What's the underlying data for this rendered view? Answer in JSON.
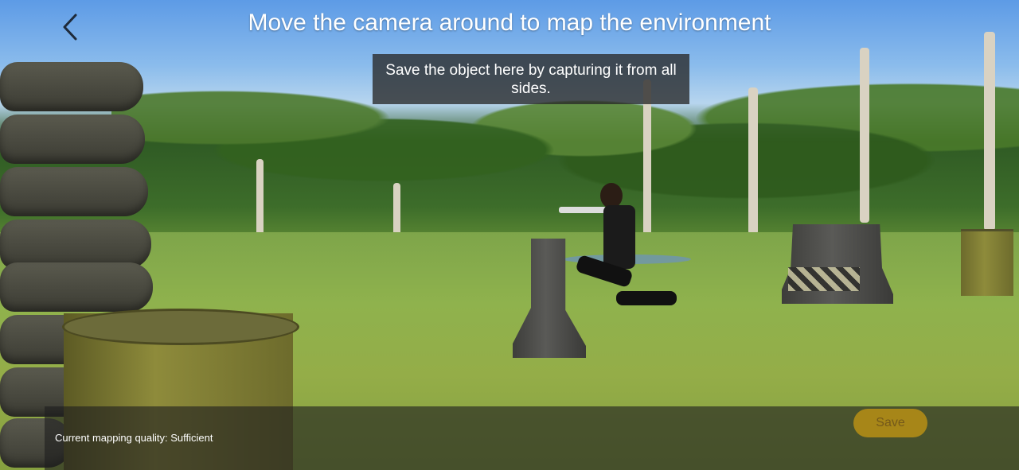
{
  "header": {
    "back_icon": "chevron-left-icon",
    "instruction": "Move the camera around to map the environment"
  },
  "hint": {
    "text": "Save the object here by capturing it from all sides."
  },
  "footer": {
    "quality_label": "Current mapping quality: Sufficient",
    "save_label": "Save"
  },
  "colors": {
    "save_button": "#a78618",
    "overlay": "#282828",
    "text": "#ffffff"
  }
}
